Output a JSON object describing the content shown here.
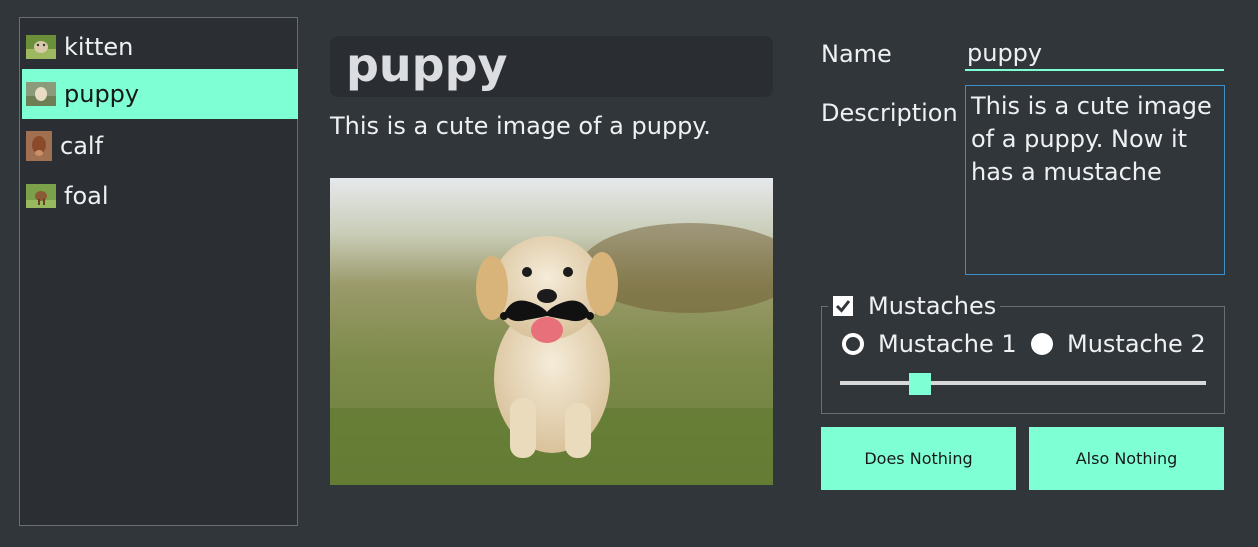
{
  "list": {
    "items": [
      {
        "label": "kitten",
        "icon": "kitten-thumbnail"
      },
      {
        "label": "puppy",
        "icon": "puppy-thumbnail",
        "selected": true
      },
      {
        "label": "calf",
        "icon": "calf-thumbnail"
      },
      {
        "label": "foal",
        "icon": "foal-thumbnail"
      }
    ]
  },
  "detail": {
    "title": "puppy",
    "description": "This is a cute image of a puppy."
  },
  "form": {
    "name_label": "Name",
    "name_value": "puppy",
    "description_label": "Description",
    "description_value": "This is a cute image of a puppy. Now it has a mustache",
    "mustaches_group": {
      "title": "Mustaches",
      "checked": true,
      "option1": "Mustache 1",
      "option2": "Mustache 2",
      "selected_option": "Mustache 2",
      "slider_fraction": 0.22
    },
    "button1": "Does Nothing",
    "button2": "Also Nothing"
  },
  "colors": {
    "accent": "#7fffd4",
    "background": "#31363b",
    "focus_border": "#3d8ec9"
  }
}
